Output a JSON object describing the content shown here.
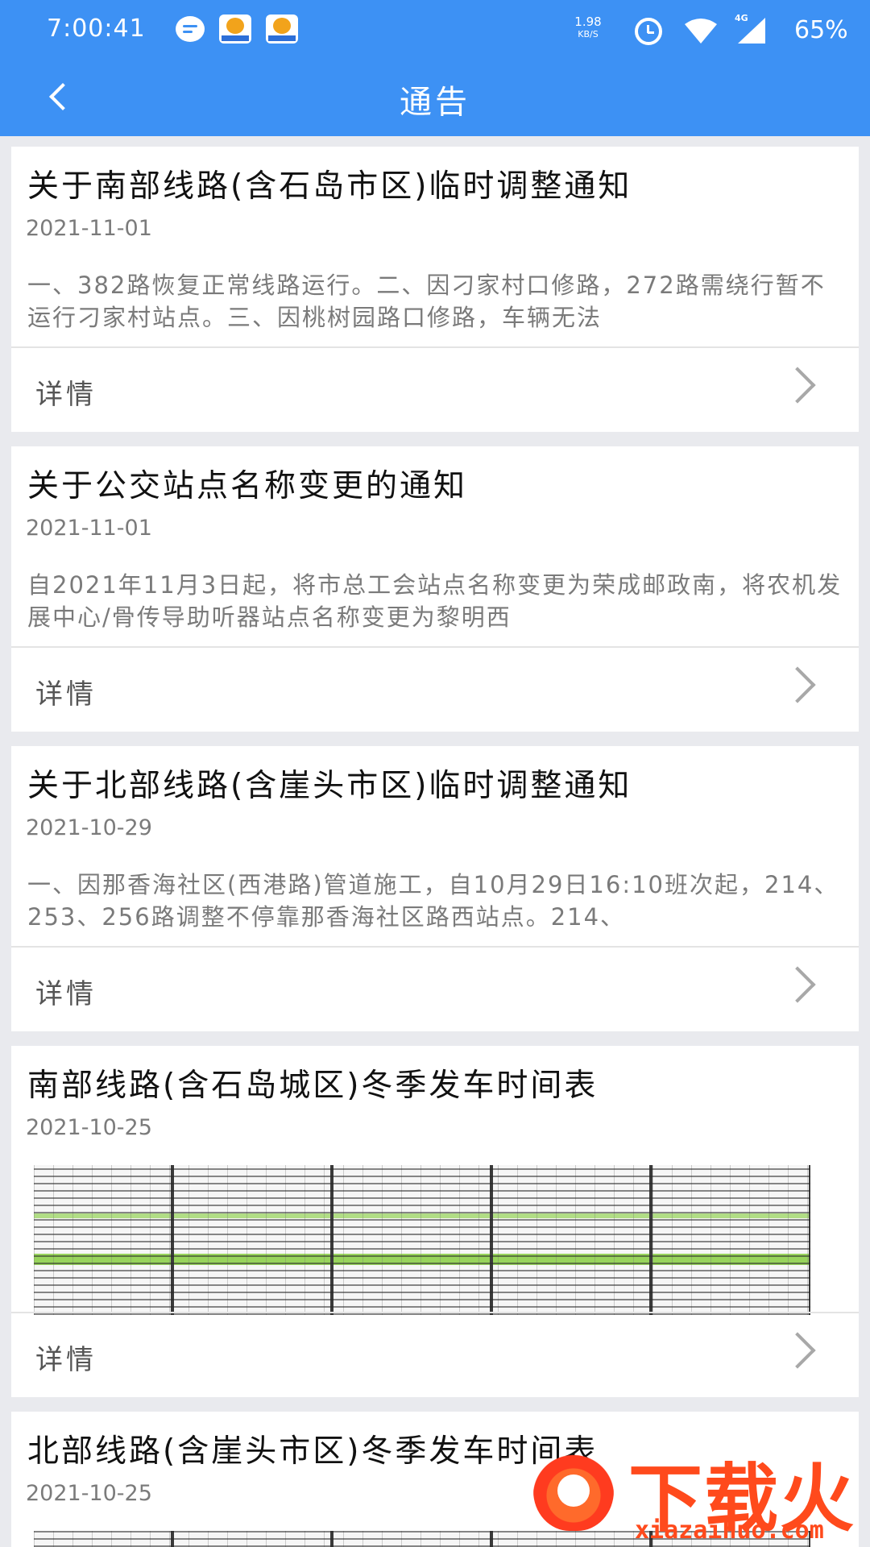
{
  "status_bar": {
    "time": "7:00:41",
    "network_speed": "1.98",
    "network_speed_unit": "KB/S",
    "network_type": "4G",
    "battery": "65%"
  },
  "header": {
    "title": "通告",
    "back_icon": "chevron-left-icon",
    "color": "#3d91f4"
  },
  "notices": [
    {
      "title": "关于南部线路(含石岛市区)临时调整通知",
      "date": "2021-11-01",
      "summary": "一、382路恢复正常线路运行。二、因刁家村口修路，272路需绕行暂不运行刁家村站点。三、因桃树园路口修路，车辆无法",
      "details_label": "详情"
    },
    {
      "title": "关于公交站点名称变更的通知",
      "date": "2021-11-01",
      "summary": "自2021年11月3日起，将市总工会站点名称变更为荣成邮政南，将农机发展中心/骨传导助听器站点名称变更为黎明西",
      "details_label": "详情"
    },
    {
      "title": "关于北部线路(含崖头市区)临时调整通知",
      "date": "2021-10-29",
      "summary": "一、因那香海社区(西港路)管道施工，自10月29日16:10班次起，214、253、256路调整不停靠那香海社区路西站点。214、",
      "details_label": "详情"
    },
    {
      "title": "南部线路(含石岛城区)冬季发车时间表",
      "date": "2021-10-25",
      "details_label": "详情"
    },
    {
      "title": "北部线路(含崖头市区)冬季发车时间表",
      "date": "2021-10-25"
    }
  ],
  "watermark": {
    "brand": "下载火",
    "url": "xiazaihuo.com"
  }
}
